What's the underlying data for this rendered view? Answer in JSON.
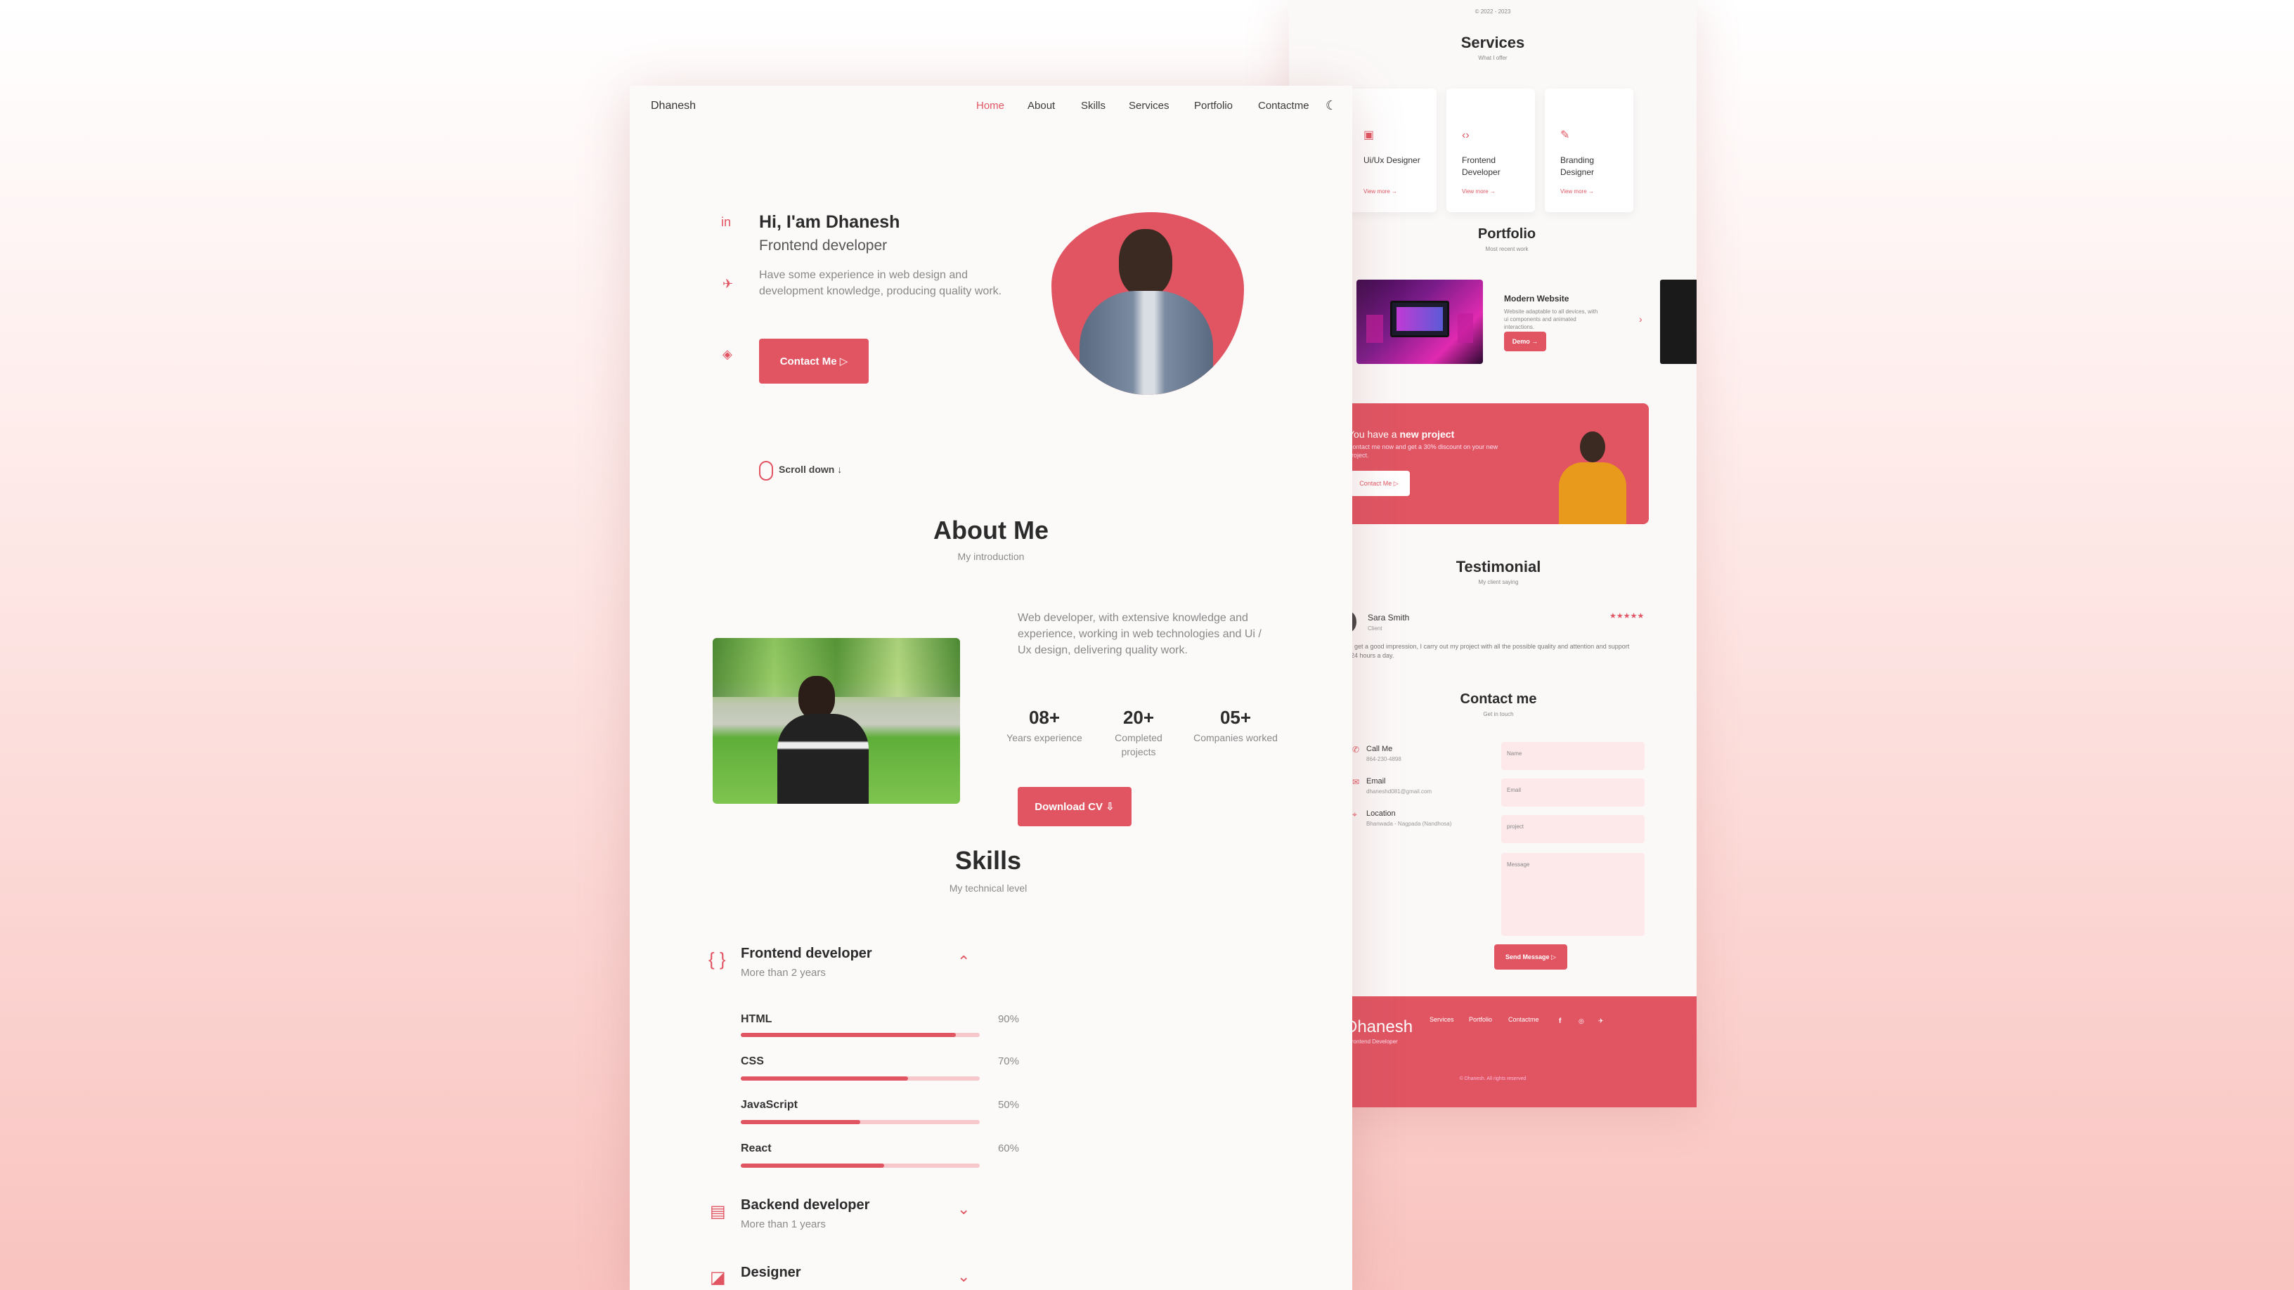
{
  "colors": {
    "accent": "#e15563",
    "accent_light": "#f6c8cc",
    "page_bg": "#fcfaf9"
  },
  "back": {
    "copyright_top": "© 2022 - 2023",
    "services": {
      "title": "Services",
      "subtitle": "What I offer",
      "cards": [
        {
          "icon": "layout-icon",
          "title": "Ui/Ux Designer",
          "more": "View more →"
        },
        {
          "icon": "code-icon",
          "title": "Frontend Developer",
          "more": "View more →"
        },
        {
          "icon": "pen-icon",
          "title": "Branding Designer",
          "more": "View more →"
        }
      ]
    },
    "portfolio": {
      "title": "Portfolio",
      "subtitle": "Most recent work",
      "item_title": "Modern Website",
      "item_desc": "Website adaptable to all devices, with ui components and animated interactions.",
      "demo_label": "Demo →"
    },
    "project": {
      "title_prefix": "You have a ",
      "title_bold": "new project",
      "desc": "Contact me now and get a 30% discount on your new project.",
      "button": "Contact Me ▷"
    },
    "testimonial": {
      "title": "Testimonial",
      "subtitle": "My client saying",
      "name": "Sara Smith",
      "role": "Client",
      "stars": "★★★★★",
      "text": "I get a good impression, I carry out my project with all the possible quality and attention and support 24 hours a day."
    },
    "contact": {
      "title": "Contact me",
      "subtitle": "Get in touch",
      "items": [
        {
          "icon": "phone-icon",
          "label": "Call Me",
          "value": "864-230-4898"
        },
        {
          "icon": "mail-icon",
          "label": "Email",
          "value": "dhaneshd081@gmail.com"
        },
        {
          "icon": "location-icon",
          "label": "Location",
          "value": "Bhanwada - Nagpada (Nandhosa)"
        }
      ],
      "fields": [
        "Name",
        "Email",
        "project",
        "Message"
      ],
      "send": "Send Message ▷"
    },
    "footer": {
      "brand": "Dhanesh",
      "role": "Frontend Developer",
      "links": [
        "Services",
        "Portfolio",
        "Contactme"
      ],
      "copyright": "© Dhanesh. All rights reserved"
    }
  },
  "front": {
    "brand": "Dhanesh",
    "nav": [
      "Home",
      "About",
      "Skills",
      "Services",
      "Portfolio",
      "Contactme"
    ],
    "hero": {
      "title": "Hi, I'am Dhanesh",
      "subtitle": "Frontend developer",
      "desc": "Have some experience in web design and development knowledge, producing quality work.",
      "button": "Contact Me ▷",
      "scroll": "Scroll down ↓"
    },
    "about": {
      "title": "About Me",
      "subtitle": "My introduction",
      "desc": "Web developer, with extensive knowledge and experience, working in web technologies and Ui / Ux design, delivering quality work.",
      "stats": [
        {
          "num": "08+",
          "label": "Years experience"
        },
        {
          "num": "20+",
          "label": "Completed projects"
        },
        {
          "num": "05+",
          "label": "Companies worked"
        }
      ],
      "button": "Download CV ⇩"
    },
    "skills": {
      "title": "Skills",
      "subtitle": "My technical level",
      "groups": [
        {
          "icon": "braces-icon",
          "title": "Frontend developer",
          "sub": "More than 2 years",
          "chevron": "⌃"
        },
        {
          "icon": "server-icon",
          "title": "Backend developer",
          "sub": "More than 1 years",
          "chevron": "⌄"
        },
        {
          "icon": "palette-icon",
          "title": "Designer",
          "sub": "",
          "chevron": "⌄"
        }
      ],
      "items": [
        {
          "name": "HTML",
          "pct": "90%",
          "value": 0.9
        },
        {
          "name": "CSS",
          "pct": "70%",
          "value": 0.7
        },
        {
          "name": "JavaScript",
          "pct": "50%",
          "value": 0.5
        },
        {
          "name": "React",
          "pct": "60%",
          "value": 0.6
        }
      ]
    }
  }
}
